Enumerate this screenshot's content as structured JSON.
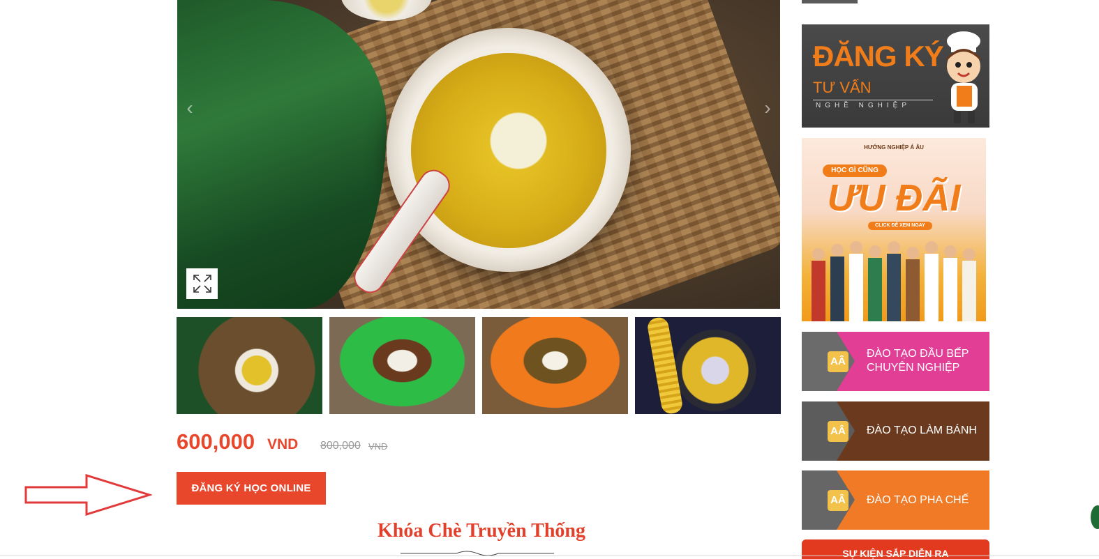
{
  "gallery": {
    "expand_icon": "expand-icon",
    "prev_icon": "chevron-left-icon",
    "next_icon": "chevron-right-icon"
  },
  "product": {
    "price": "600,000",
    "currency": "VND",
    "old_price": "800,000",
    "old_currency": "VND",
    "register_label": "ĐĂNG KÝ HỌC ONLINE",
    "course_title": "Khóa Chè Truyền Thống"
  },
  "sidebar": {
    "banner_dk": {
      "title": "ĐĂNG KÝ",
      "subtitle": "TƯ VẤN",
      "tag": "NGHỀ NGHIỆP"
    },
    "banner_ud": {
      "brand": "HƯỚNG NGHIỆP Á ÂU",
      "pill": "HỌC GÌ CŨNG",
      "headline": "ƯU ĐÃI",
      "cta": "CLICK ĐỂ XEM NGAY"
    },
    "links": [
      {
        "label_line1": "ĐÀO TẠO ĐẦU BẾP",
        "label_line2": "CHUYÊN NGHIỆP"
      },
      {
        "label_line1": "ĐÀO TẠO LÀM BÁNH",
        "label_line2": ""
      },
      {
        "label_line1": "ĐÀO TẠO PHA CHẾ",
        "label_line2": ""
      }
    ],
    "event_label": "SỰ KIỆN SẮP DIỄN RA"
  },
  "colors": {
    "accent": "#e8472c",
    "pink": "#e23e96",
    "brown": "#6b3a1e",
    "orange": "#f07a25"
  }
}
